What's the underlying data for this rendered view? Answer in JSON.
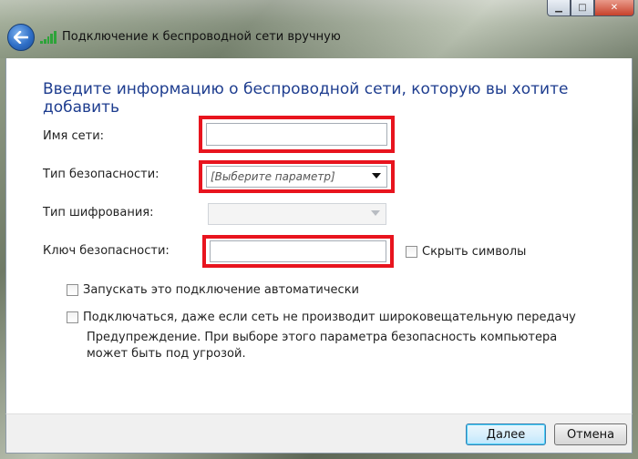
{
  "window": {
    "title": "Подключение к беспроводной сети вручную",
    "caption_buttons": [
      "minimize-icon",
      "maximize-icon",
      "close-icon"
    ],
    "back_icon": "back-arrow-icon",
    "network_icon": "wireless-signal-icon"
  },
  "heading": "Введите информацию о беспроводной сети, которую вы хотите добавить",
  "form": {
    "network_name": {
      "label": "Имя сети:",
      "value": ""
    },
    "security_type": {
      "label": "Тип безопасности:",
      "value": "[Выберите параметр]"
    },
    "encryption_type": {
      "label": "Тип шифрования:",
      "value": ""
    },
    "security_key": {
      "label": "Ключ безопасности:",
      "value": ""
    },
    "hide_chars": {
      "label": "Скрыть символы",
      "checked": false
    }
  },
  "options": {
    "auto_connect": {
      "label": "Запускать это подключение автоматически",
      "checked": false
    },
    "connect_hidden": {
      "label": "Подключаться, даже если сеть не производит широковещательную передачу",
      "checked": false
    }
  },
  "warning": "Предупреждение. При выборе этого параметра безопасность компьютера может быть под угрозой.",
  "buttons": {
    "next": "Далее",
    "cancel": "Отмена"
  },
  "colors": {
    "highlight": "#e8141e",
    "heading": "#1e3d8f"
  }
}
